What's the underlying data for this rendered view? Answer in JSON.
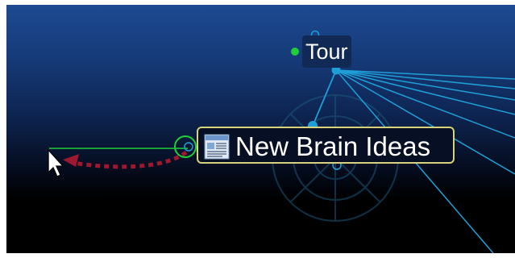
{
  "canvas": {
    "background_top": "#1d4a92",
    "background_bottom": "#000000",
    "link_color": "#1f9fd8",
    "selection_border_color": "#d8d27a",
    "gate_color": "#1ecf3a",
    "drag_link_color": "#9e1830"
  },
  "thoughts": {
    "tour": {
      "label": "Tour"
    },
    "active": {
      "label": "New Brain Ideas",
      "icon": "document-icon"
    }
  },
  "icons": {
    "cursor": "arrow-cursor-icon",
    "drag_link": "dotted-link-arrow",
    "watermark": "brain-watermark-icon"
  }
}
